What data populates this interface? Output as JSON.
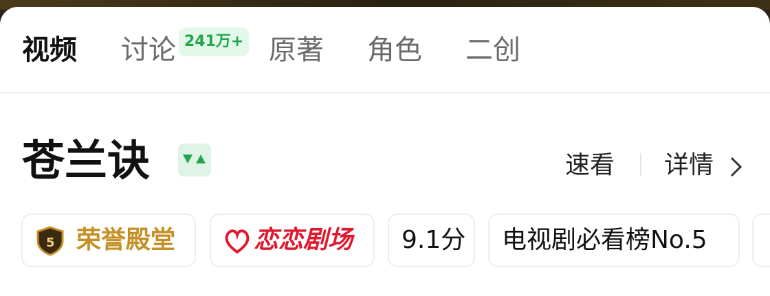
{
  "tabs": [
    {
      "label": "视频",
      "active": true
    },
    {
      "label": "讨论",
      "badge": "241万+"
    },
    {
      "label": "原著"
    },
    {
      "label": "角色"
    },
    {
      "label": "二创"
    }
  ],
  "show": {
    "title": "苍兰诀",
    "quick_view": "速看",
    "details": "详情"
  },
  "chips": {
    "honor": {
      "label": "荣誉殿堂",
      "icon_text": "5"
    },
    "theater": {
      "label": "恋恋剧场"
    },
    "score": {
      "label": "9.1分"
    },
    "rank": {
      "label": "电视剧必看榜No.5"
    }
  },
  "colors": {
    "accent_green": "#1fa64a",
    "honor_gold": "#c49026",
    "theater_red": "#e1182d"
  }
}
